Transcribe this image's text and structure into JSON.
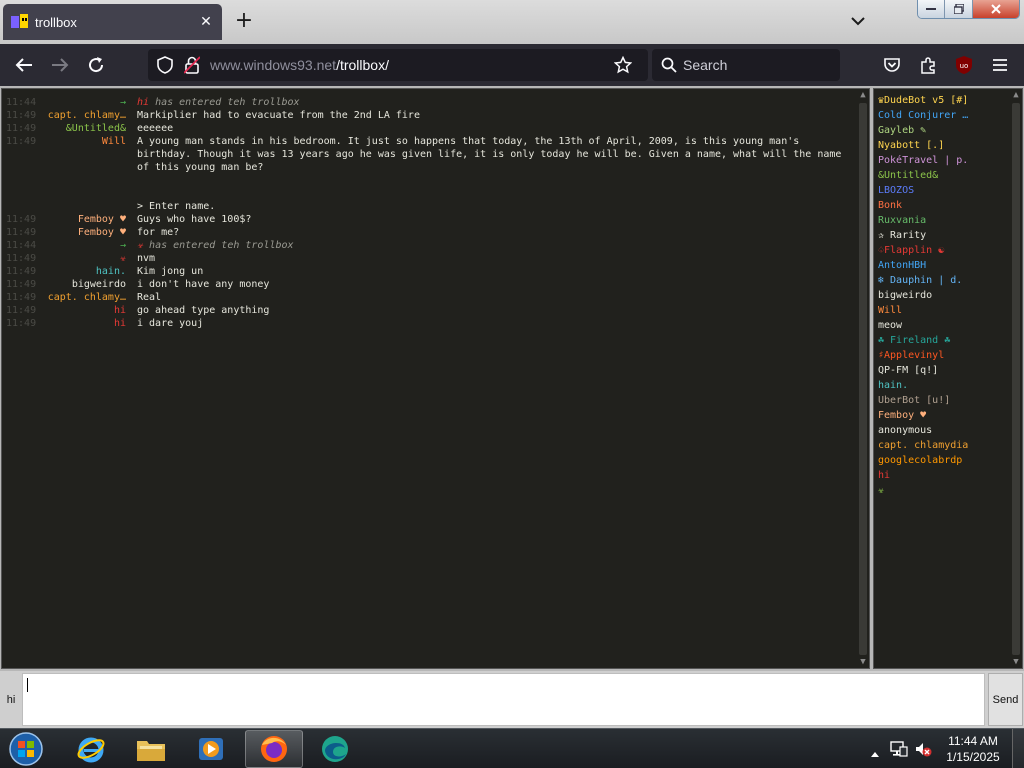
{
  "browser": {
    "tab_title": "trollbox",
    "url_domain": "www.windows93.net",
    "url_path": "/trollbox/",
    "search_placeholder": "Search",
    "extension_badge": "uo",
    "close_tab_glyph": "✕",
    "new_tab_glyph": "+"
  },
  "chat": {
    "messages": [
      {
        "time": "11:44",
        "nick": "→",
        "nick_color": "#4caf50",
        "text_nick": "hi",
        "text_nick_color": "#e53935",
        "text": " has entered teh trollbox",
        "system": true
      },
      {
        "time": "11:49",
        "nick": "capt. chlamy…",
        "nick_color": "#f0a030",
        "text": "Markiplier had to evacuate from the 2nd LA fire"
      },
      {
        "time": "11:49",
        "nick": "&Untitled&",
        "nick_color": "#8bc34a",
        "text": "eeeeee"
      },
      {
        "time": "11:49",
        "nick": "Will",
        "nick_color": "#ff8a3d",
        "text": "A young man stands in his bedroom. It just so happens that today, the 13th of April, 2009, is this young man's\nbirthday. Though it was 13 years ago he was given life, it is only today he will be. Given a name, what will the name\nof this young man be?\n\n\n> Enter name."
      },
      {
        "time": "11:49",
        "nick": "Femboy ♥",
        "nick_color": "#ffb07c",
        "text": "Guys who have 100$?"
      },
      {
        "time": "11:49",
        "nick": "Femboy ♥",
        "nick_color": "#ffb07c",
        "text": "for me?"
      },
      {
        "time": "11:44",
        "nick": "→",
        "nick_color": "#4caf50",
        "text_nick": "☣",
        "text_nick_color": "#e53935",
        "text": " has entered teh trollbox",
        "system": true
      },
      {
        "time": "11:49",
        "nick": "☣",
        "nick_color": "#e53935",
        "text": "nvm"
      },
      {
        "time": "11:49",
        "nick": "hain.",
        "nick_color": "#4fc3c3",
        "text": "Kim jong un"
      },
      {
        "time": "11:49",
        "nick": "bigweirdo",
        "nick_color": "#e6e6dc",
        "text": "i don't have any money"
      },
      {
        "time": "11:49",
        "nick": "capt. chlamy…",
        "nick_color": "#f0a030",
        "text": "Real"
      },
      {
        "time": "11:49",
        "nick": "hi",
        "nick_color": "#e53935",
        "text": "go ahead type anything"
      },
      {
        "time": "11:49",
        "nick": "hi",
        "nick_color": "#e53935",
        "text": "i dare youj"
      }
    ]
  },
  "users": [
    {
      "name": "♛DudeBot v5 [#]",
      "color": "#ffd54f"
    },
    {
      "name": "Cold Conjurer …",
      "color": "#42a5f5"
    },
    {
      "name": "Gayleb ✎",
      "color": "#aed581"
    },
    {
      "name": "Nyabott [.]",
      "color": "#ffd54f"
    },
    {
      "name": "PokéTravel | p.",
      "color": "#ce93d8"
    },
    {
      "name": "&Untitled&",
      "color": "#8bc34a"
    },
    {
      "name": "LBOZOS",
      "color": "#5c7cfa"
    },
    {
      "name": "Bonk",
      "color": "#ff7043"
    },
    {
      "name": "Ruxvania",
      "color": "#66bb6a"
    },
    {
      "name": "✰ Rarity",
      "color": "#e6e6dc"
    },
    {
      "name": "♤Flapplin ☯",
      "color": "#e53935"
    },
    {
      "name": "AntonHBH",
      "color": "#42a5f5"
    },
    {
      "name": "❄ Dauphin | d.",
      "color": "#64b5f6"
    },
    {
      "name": "bigweirdo",
      "color": "#e6e6dc"
    },
    {
      "name": "Will",
      "color": "#ff8a3d"
    },
    {
      "name": "meow",
      "color": "#e6e6dc"
    },
    {
      "name": "☘ Fireland ☘",
      "color": "#26a69a"
    },
    {
      "name": "♯Applevinyl",
      "color": "#ff5722"
    },
    {
      "name": "QP-FM [q!]",
      "color": "#e6e6dc"
    },
    {
      "name": "hain.",
      "color": "#4fc3c3"
    },
    {
      "name": "UberBot [u!]",
      "color": "#b0a090"
    },
    {
      "name": "Femboy ♥",
      "color": "#ffb07c"
    },
    {
      "name": "anonymous",
      "color": "#e6e6dc"
    },
    {
      "name": "capt. chlamydia",
      "color": "#f0a030"
    },
    {
      "name": "googlecolabrdp",
      "color": "#ff9800"
    },
    {
      "name": "hi",
      "color": "#e53935"
    },
    {
      "name": "☣",
      "color": "#8bc34a"
    }
  ],
  "input": {
    "nick_label": "hi",
    "value": "",
    "send_label": "Send"
  },
  "taskbar": {
    "time": "11:44 AM",
    "date": "1/15/2025",
    "apps": [
      "start-orb",
      "internet-explorer",
      "file-explorer",
      "media-player",
      "firefox",
      "edge"
    ],
    "active_app": "firefox"
  },
  "colors": {
    "chat_bg": "#21211d",
    "browser_toolbar": "#2b2a33",
    "accent_red": "#e53935"
  }
}
